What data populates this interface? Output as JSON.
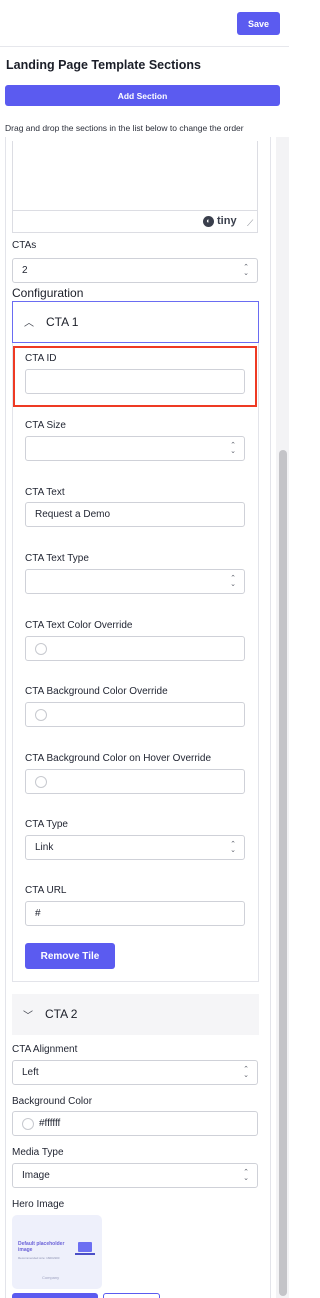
{
  "header": {
    "save_label": "Save"
  },
  "page": {
    "title": "Landing Page Template Sections",
    "add_section_label": "Add Section",
    "instruction": "Drag and drop the sections in the list below to change the order"
  },
  "editor": {
    "brand": "tiny"
  },
  "ctas": {
    "label": "CTAs",
    "value": "2"
  },
  "configuration_label": "Configuration",
  "cta1": {
    "title": "CTA 1",
    "fields": {
      "cta_id": {
        "label": "CTA ID",
        "value": ""
      },
      "cta_size": {
        "label": "CTA Size",
        "value": ""
      },
      "cta_text": {
        "label": "CTA Text",
        "value": "Request a Demo"
      },
      "cta_text_type": {
        "label": "CTA Text Type",
        "value": ""
      },
      "text_color_override": {
        "label": "CTA Text Color Override",
        "value": ""
      },
      "bg_color_override": {
        "label": "CTA Background Color Override",
        "value": ""
      },
      "bg_hover_override": {
        "label": "CTA Background Color on Hover Override",
        "value": ""
      },
      "cta_type": {
        "label": "CTA Type",
        "value": "Link"
      },
      "cta_url": {
        "label": "CTA URL",
        "value": "#"
      }
    },
    "remove_label": "Remove Tile"
  },
  "cta2": {
    "title": "CTA 2"
  },
  "cta_alignment": {
    "label": "CTA Alignment",
    "value": "Left"
  },
  "background_color": {
    "label": "Background Color",
    "value": "#ffffff"
  },
  "media_type": {
    "label": "Media Type",
    "value": "Image"
  },
  "hero_image": {
    "label": "Hero Image",
    "placeholder_title": "Default placeholder image",
    "placeholder_sub": "Recommended size: 1600x900",
    "placeholder_brand": "Company"
  },
  "colors": {
    "accent": "#5b5bf0",
    "highlight": "#ee3a24",
    "border": "#cfd1d8"
  }
}
